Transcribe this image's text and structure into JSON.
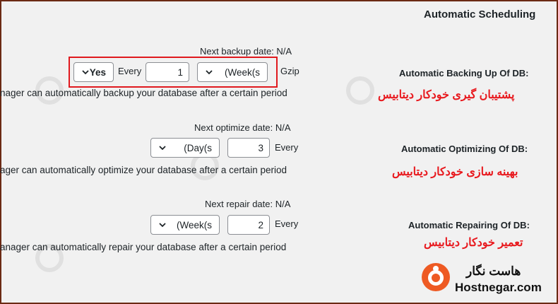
{
  "section_title": "Automatic Scheduling",
  "backup": {
    "label_en": "Automatic Backing Up Of DB:",
    "label_fa": "پشتیبان گیری خودکار دیتابیس",
    "next_date": "Next backup date: N/A",
    "enabled_value": "Yes",
    "every_label": "Every",
    "interval": "1",
    "unit": "(Week(s",
    "gzip_label": "Gzip",
    "description": "nager can automatically backup your database after a certain period"
  },
  "optimize": {
    "label_en": "Automatic Optimizing Of DB:",
    "label_fa": "بهینه سازی خودکار دیتابیس",
    "next_date": "Next optimize date: N/A",
    "unit": "(Day(s",
    "interval": "3",
    "every_label": "Every",
    "description": "ager can automatically optimize your database after a certain period"
  },
  "repair": {
    "label_en": "Automatic Repairing Of DB:",
    "label_fa": "تعمیر خودکار دیتابیس",
    "next_date": "Next repair date: N/A",
    "unit": "(Week(s",
    "interval": "2",
    "every_label": "Every",
    "description": "anager can automatically repair your database after a certain period"
  },
  "logo": {
    "name_fa": "هاست نگار",
    "name_en": "Hostnegar.com"
  },
  "colors": {
    "accent_red": "#e8191e",
    "logo_orange": "#ee5a23"
  }
}
